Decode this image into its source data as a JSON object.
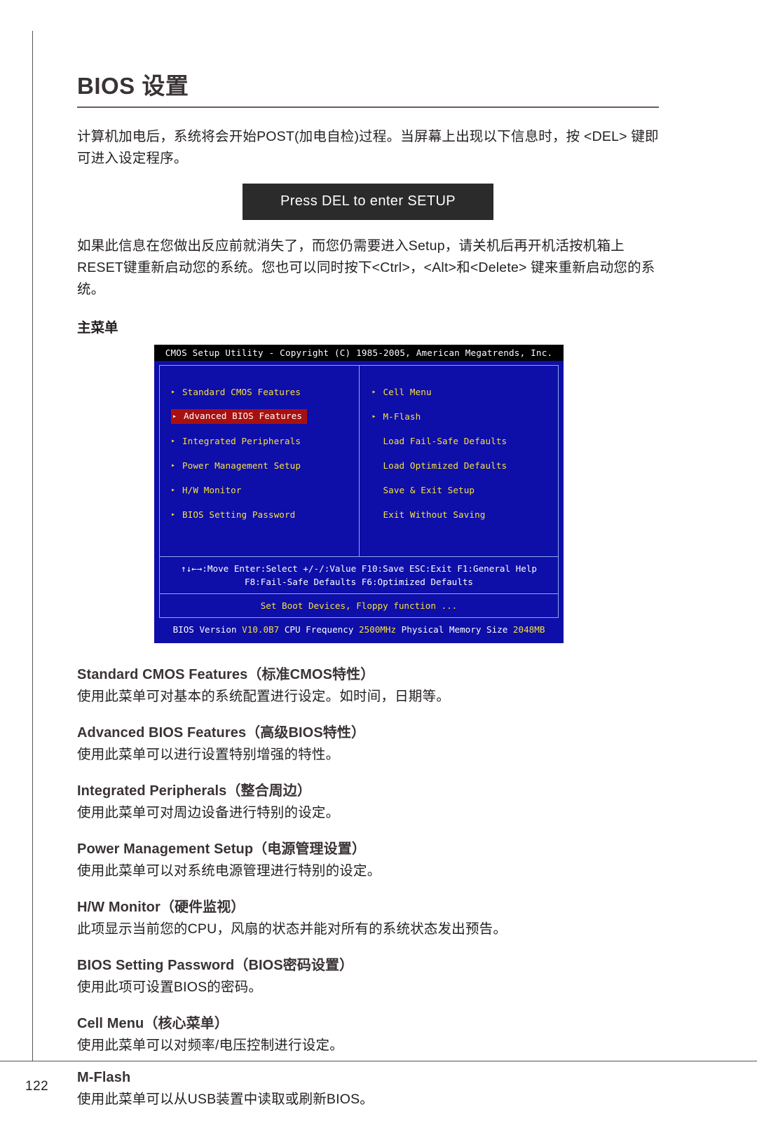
{
  "page": {
    "title": "BIOS 设置",
    "number": "122"
  },
  "intro": {
    "paragraph1": "计算机加电后，系统将会开始POST(加电自检)过程。当屏幕上出现以下信息时，按 <DEL> 键即可进入设定程序。",
    "banner": "Press DEL to enter SETUP",
    "paragraph2": "如果此信息在您做出反应前就消失了，而您仍需要进入Setup，请关机后再开机活按机箱上RESET键重新启动您的系统。您也可以同时按下<Ctrl>，<Alt>和<Delete> 键来重新启动您的系统。",
    "subhead": "主菜单"
  },
  "bios": {
    "titlebar": "CMOS Setup Utility - Copyright (C) 1985-2005, American Megatrends, Inc.",
    "left_items": [
      {
        "label": "Standard CMOS Features",
        "arrow": true,
        "selected": false
      },
      {
        "label": "Advanced BIOS Features",
        "arrow": true,
        "selected": true
      },
      {
        "label": "Integrated Peripherals",
        "arrow": true,
        "selected": false
      },
      {
        "label": "Power Management Setup",
        "arrow": true,
        "selected": false
      },
      {
        "label": "H/W Monitor",
        "arrow": true,
        "selected": false
      },
      {
        "label": "BIOS Setting Password",
        "arrow": true,
        "selected": false
      }
    ],
    "right_items": [
      {
        "label": "Cell Menu",
        "arrow": true,
        "selected": false
      },
      {
        "label": "M-Flash",
        "arrow": true,
        "selected": false
      },
      {
        "label": "Load Fail-Safe Defaults",
        "arrow": false,
        "selected": false
      },
      {
        "label": "Load Optimized Defaults",
        "arrow": false,
        "selected": false
      },
      {
        "label": "Save & Exit Setup",
        "arrow": false,
        "selected": false
      },
      {
        "label": "Exit Without Saving",
        "arrow": false,
        "selected": false
      }
    ],
    "help_line1": "↑↓←→:Move  Enter:Select  +/-/:Value  F10:Save  ESC:Exit  F1:General Help",
    "help_line2": "F8:Fail-Safe Defaults   F6:Optimized Defaults",
    "status": "Set Boot Devices, Floppy function ...",
    "version": {
      "bios_label": "BIOS Version",
      "bios_value": "V10.0B7",
      "cpu_label": "CPU Frequency",
      "cpu_value": "2500MHz",
      "mem_label": "Physical Memory Size",
      "mem_value": "2048MB"
    },
    "colors": {
      "background": "#0e0ea8",
      "text": "#f5e03c",
      "highlight": "#a81010",
      "titlebar": "#000000"
    }
  },
  "sections": [
    {
      "heading": "Standard CMOS Features（标准CMOS特性）",
      "desc": "使用此菜单可对基本的系统配置进行设定。如时间，日期等。"
    },
    {
      "heading": "Advanced BIOS Features（高级BIOS特性）",
      "desc": "使用此菜单可以进行设置特别增强的特性。"
    },
    {
      "heading": "Integrated Peripherals（整合周边）",
      "desc": "使用此菜单可对周边设备进行特别的设定。"
    },
    {
      "heading": "Power Management Setup（电源管理设置）",
      "desc": "使用此菜单可以对系统电源管理进行特别的设定。"
    },
    {
      "heading": "H/W Monitor（硬件监视）",
      "desc": "此项显示当前您的CPU，风扇的状态并能对所有的系统状态发出预告。"
    },
    {
      "heading": "BIOS Setting Password（BIOS密码设置）",
      "desc": "使用此项可设置BIOS的密码。"
    },
    {
      "heading": "Cell Menu（核心菜单）",
      "desc": "使用此菜单可以对频率/电压控制进行设定。"
    },
    {
      "heading": "M-Flash",
      "desc": "使用此菜单可以从USB装置中读取或刷新BIOS。"
    }
  ]
}
